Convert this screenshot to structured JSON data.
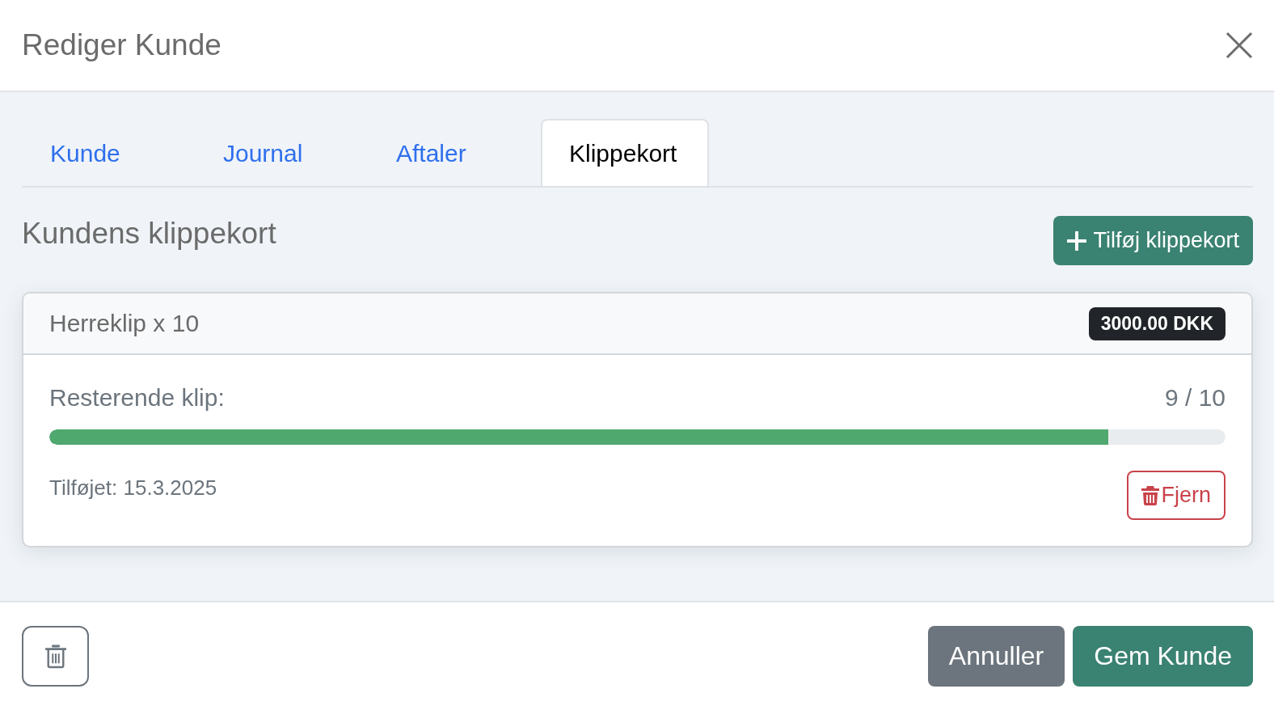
{
  "dialog": {
    "title": "Rediger Kunde"
  },
  "tabs": [
    {
      "label": "Kunde",
      "selected": false
    },
    {
      "label": "Journal",
      "selected": false
    },
    {
      "label": "Aftaler",
      "selected": false
    },
    {
      "label": "Klippekort",
      "selected": true
    }
  ],
  "section": {
    "title": "Kundens klippekort",
    "add_button": "Tilføj klippekort"
  },
  "cards": [
    {
      "name": "Herreklip x 10",
      "price": "3000.00 DKK",
      "remaining_label": "Resterende klip:",
      "remaining": "9 / 10",
      "level": 0.9,
      "added": "Tilføjet: 15.3.2025",
      "remove_button": "Fjern"
    }
  ],
  "footer": {
    "buttons": [
      {
        "label": "Annuller",
        "kind": "secondary"
      },
      {
        "label": "Gem Kunde",
        "kind": "primary"
      }
    ]
  }
}
